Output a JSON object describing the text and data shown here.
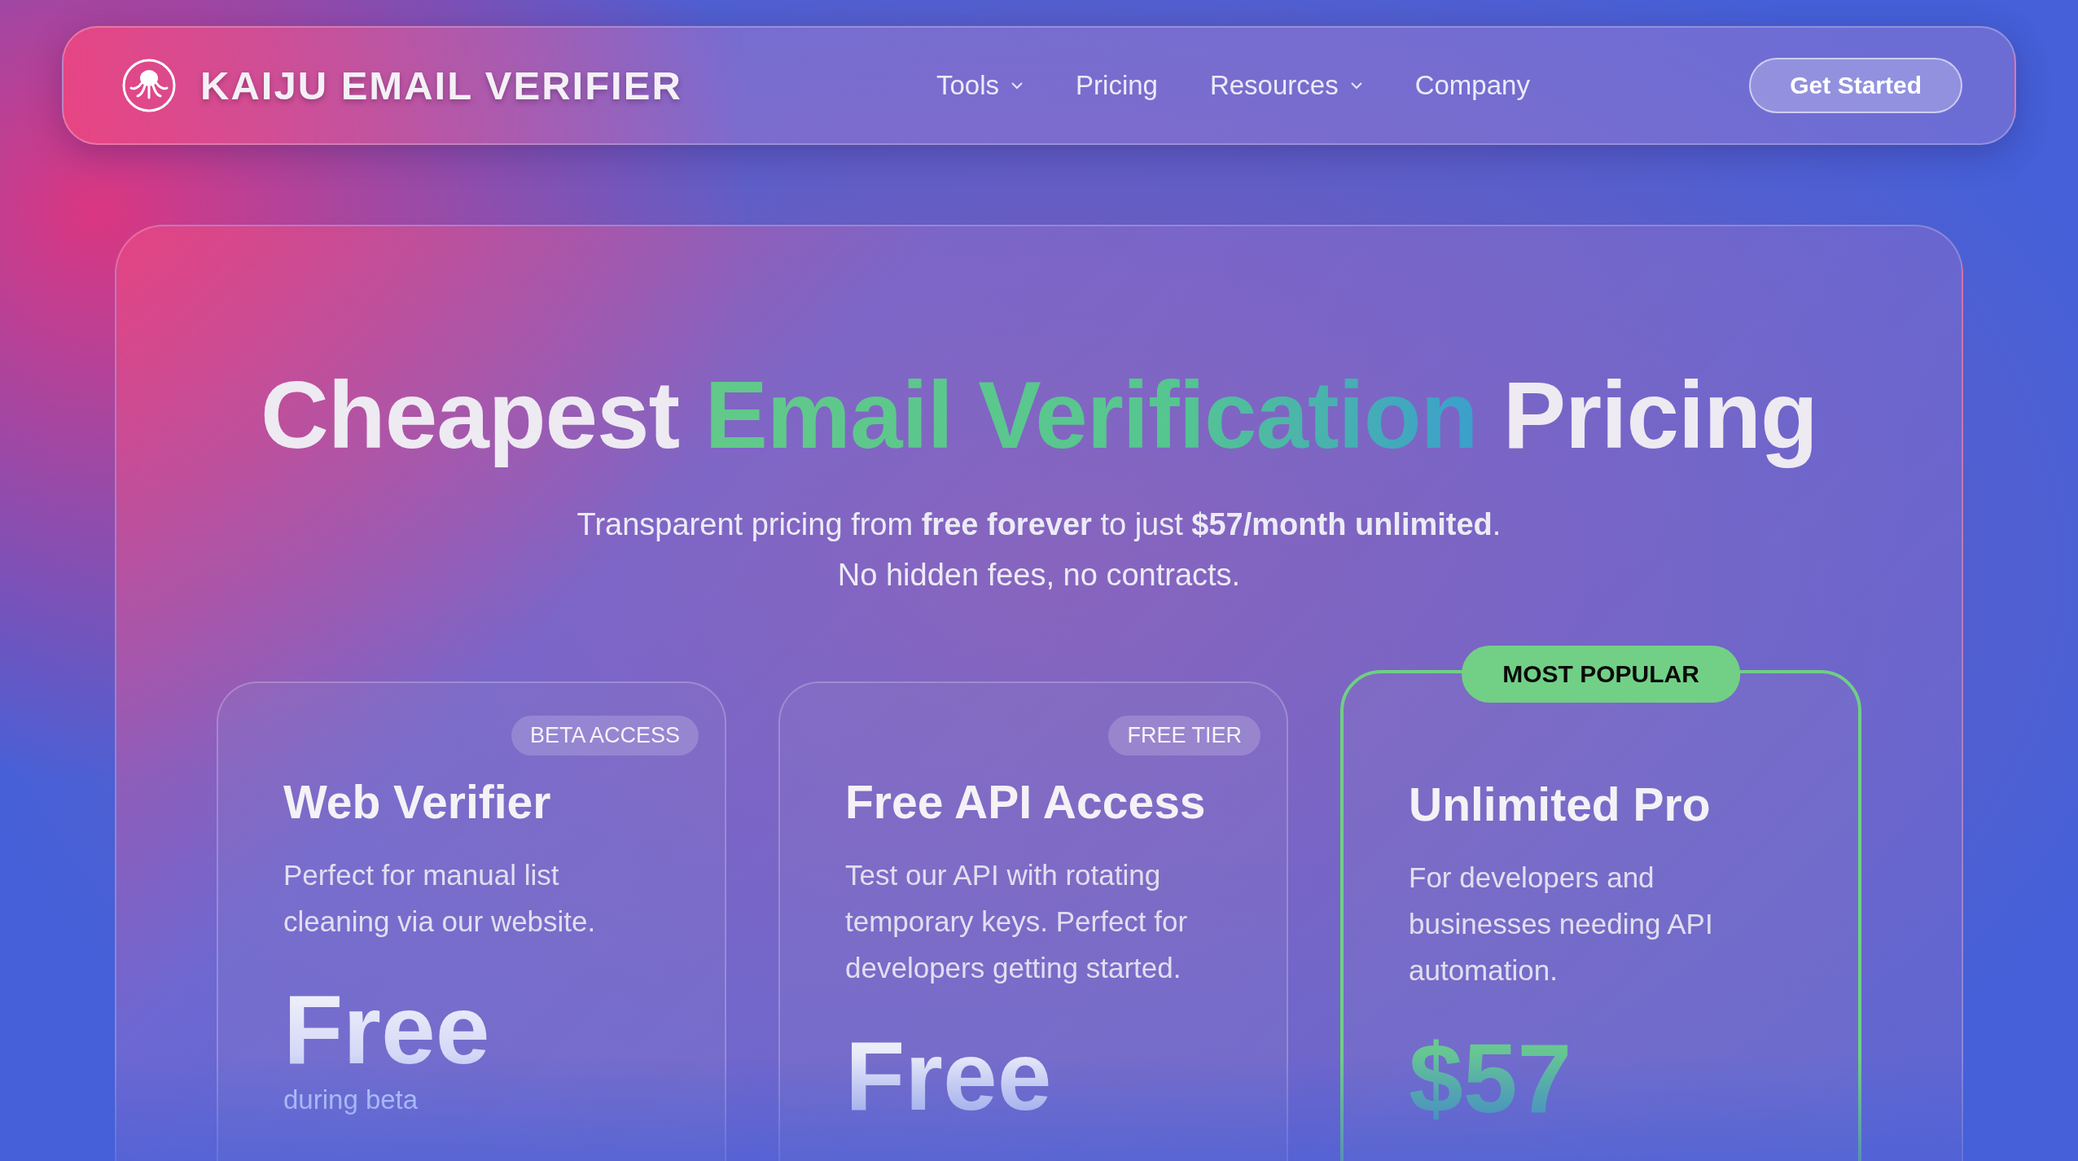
{
  "nav": {
    "brand": "KAIJU EMAIL VERIFIER",
    "links": [
      {
        "label": "Tools",
        "dropdown": true
      },
      {
        "label": "Pricing",
        "dropdown": false
      },
      {
        "label": "Resources",
        "dropdown": true
      },
      {
        "label": "Company",
        "dropdown": false
      }
    ],
    "cta": "Get Started"
  },
  "hero": {
    "headline": {
      "before": "Cheapest",
      "highlight": "Email Verification",
      "after": "Pricing"
    },
    "subtitle": [
      "Transparent pricing from **free forever** to just **$57/month unlimited**.",
      "No hidden fees, no contracts."
    ]
  },
  "plans": [
    {
      "badge": "BETA ACCESS",
      "featured": false,
      "title": "Web Verifier",
      "description": "Perfect for manual list cleaning via our website.",
      "price": "Free",
      "price_note": "during beta"
    },
    {
      "badge": "FREE TIER",
      "featured": false,
      "title": "Free API Access",
      "description": "Test our API with rotating temporary keys. Perfect for developers getting started.",
      "price": "Free"
    },
    {
      "badge": "MOST POPULAR",
      "featured": true,
      "title": "Unlimited Pro",
      "description": "For developers and businesses needing API automation.",
      "price": "$57"
    }
  ]
}
